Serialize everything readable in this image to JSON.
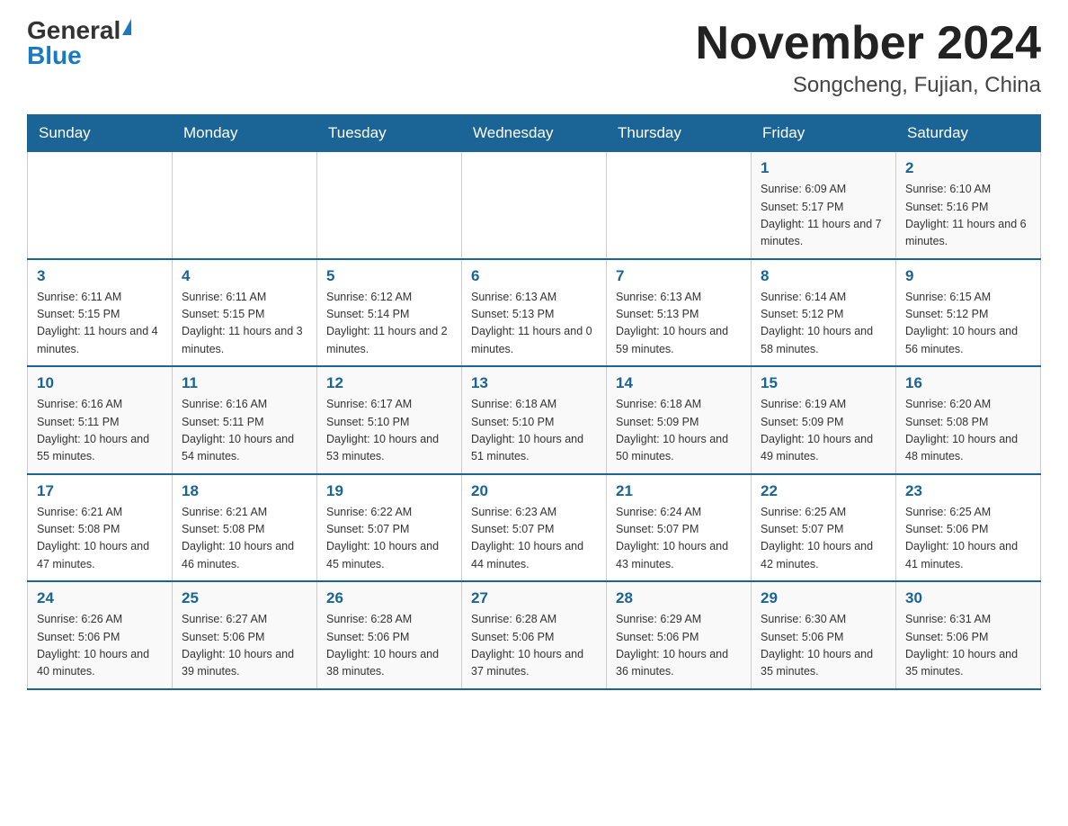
{
  "header": {
    "logo_general": "General",
    "logo_blue": "Blue",
    "month_title": "November 2024",
    "location": "Songcheng, Fujian, China"
  },
  "weekdays": [
    "Sunday",
    "Monday",
    "Tuesday",
    "Wednesday",
    "Thursday",
    "Friday",
    "Saturday"
  ],
  "weeks": [
    [
      {
        "day": "",
        "info": ""
      },
      {
        "day": "",
        "info": ""
      },
      {
        "day": "",
        "info": ""
      },
      {
        "day": "",
        "info": ""
      },
      {
        "day": "",
        "info": ""
      },
      {
        "day": "1",
        "info": "Sunrise: 6:09 AM\nSunset: 5:17 PM\nDaylight: 11 hours and 7 minutes."
      },
      {
        "day": "2",
        "info": "Sunrise: 6:10 AM\nSunset: 5:16 PM\nDaylight: 11 hours and 6 minutes."
      }
    ],
    [
      {
        "day": "3",
        "info": "Sunrise: 6:11 AM\nSunset: 5:15 PM\nDaylight: 11 hours and 4 minutes."
      },
      {
        "day": "4",
        "info": "Sunrise: 6:11 AM\nSunset: 5:15 PM\nDaylight: 11 hours and 3 minutes."
      },
      {
        "day": "5",
        "info": "Sunrise: 6:12 AM\nSunset: 5:14 PM\nDaylight: 11 hours and 2 minutes."
      },
      {
        "day": "6",
        "info": "Sunrise: 6:13 AM\nSunset: 5:13 PM\nDaylight: 11 hours and 0 minutes."
      },
      {
        "day": "7",
        "info": "Sunrise: 6:13 AM\nSunset: 5:13 PM\nDaylight: 10 hours and 59 minutes."
      },
      {
        "day": "8",
        "info": "Sunrise: 6:14 AM\nSunset: 5:12 PM\nDaylight: 10 hours and 58 minutes."
      },
      {
        "day": "9",
        "info": "Sunrise: 6:15 AM\nSunset: 5:12 PM\nDaylight: 10 hours and 56 minutes."
      }
    ],
    [
      {
        "day": "10",
        "info": "Sunrise: 6:16 AM\nSunset: 5:11 PM\nDaylight: 10 hours and 55 minutes."
      },
      {
        "day": "11",
        "info": "Sunrise: 6:16 AM\nSunset: 5:11 PM\nDaylight: 10 hours and 54 minutes."
      },
      {
        "day": "12",
        "info": "Sunrise: 6:17 AM\nSunset: 5:10 PM\nDaylight: 10 hours and 53 minutes."
      },
      {
        "day": "13",
        "info": "Sunrise: 6:18 AM\nSunset: 5:10 PM\nDaylight: 10 hours and 51 minutes."
      },
      {
        "day": "14",
        "info": "Sunrise: 6:18 AM\nSunset: 5:09 PM\nDaylight: 10 hours and 50 minutes."
      },
      {
        "day": "15",
        "info": "Sunrise: 6:19 AM\nSunset: 5:09 PM\nDaylight: 10 hours and 49 minutes."
      },
      {
        "day": "16",
        "info": "Sunrise: 6:20 AM\nSunset: 5:08 PM\nDaylight: 10 hours and 48 minutes."
      }
    ],
    [
      {
        "day": "17",
        "info": "Sunrise: 6:21 AM\nSunset: 5:08 PM\nDaylight: 10 hours and 47 minutes."
      },
      {
        "day": "18",
        "info": "Sunrise: 6:21 AM\nSunset: 5:08 PM\nDaylight: 10 hours and 46 minutes."
      },
      {
        "day": "19",
        "info": "Sunrise: 6:22 AM\nSunset: 5:07 PM\nDaylight: 10 hours and 45 minutes."
      },
      {
        "day": "20",
        "info": "Sunrise: 6:23 AM\nSunset: 5:07 PM\nDaylight: 10 hours and 44 minutes."
      },
      {
        "day": "21",
        "info": "Sunrise: 6:24 AM\nSunset: 5:07 PM\nDaylight: 10 hours and 43 minutes."
      },
      {
        "day": "22",
        "info": "Sunrise: 6:25 AM\nSunset: 5:07 PM\nDaylight: 10 hours and 42 minutes."
      },
      {
        "day": "23",
        "info": "Sunrise: 6:25 AM\nSunset: 5:06 PM\nDaylight: 10 hours and 41 minutes."
      }
    ],
    [
      {
        "day": "24",
        "info": "Sunrise: 6:26 AM\nSunset: 5:06 PM\nDaylight: 10 hours and 40 minutes."
      },
      {
        "day": "25",
        "info": "Sunrise: 6:27 AM\nSunset: 5:06 PM\nDaylight: 10 hours and 39 minutes."
      },
      {
        "day": "26",
        "info": "Sunrise: 6:28 AM\nSunset: 5:06 PM\nDaylight: 10 hours and 38 minutes."
      },
      {
        "day": "27",
        "info": "Sunrise: 6:28 AM\nSunset: 5:06 PM\nDaylight: 10 hours and 37 minutes."
      },
      {
        "day": "28",
        "info": "Sunrise: 6:29 AM\nSunset: 5:06 PM\nDaylight: 10 hours and 36 minutes."
      },
      {
        "day": "29",
        "info": "Sunrise: 6:30 AM\nSunset: 5:06 PM\nDaylight: 10 hours and 35 minutes."
      },
      {
        "day": "30",
        "info": "Sunrise: 6:31 AM\nSunset: 5:06 PM\nDaylight: 10 hours and 35 minutes."
      }
    ]
  ]
}
